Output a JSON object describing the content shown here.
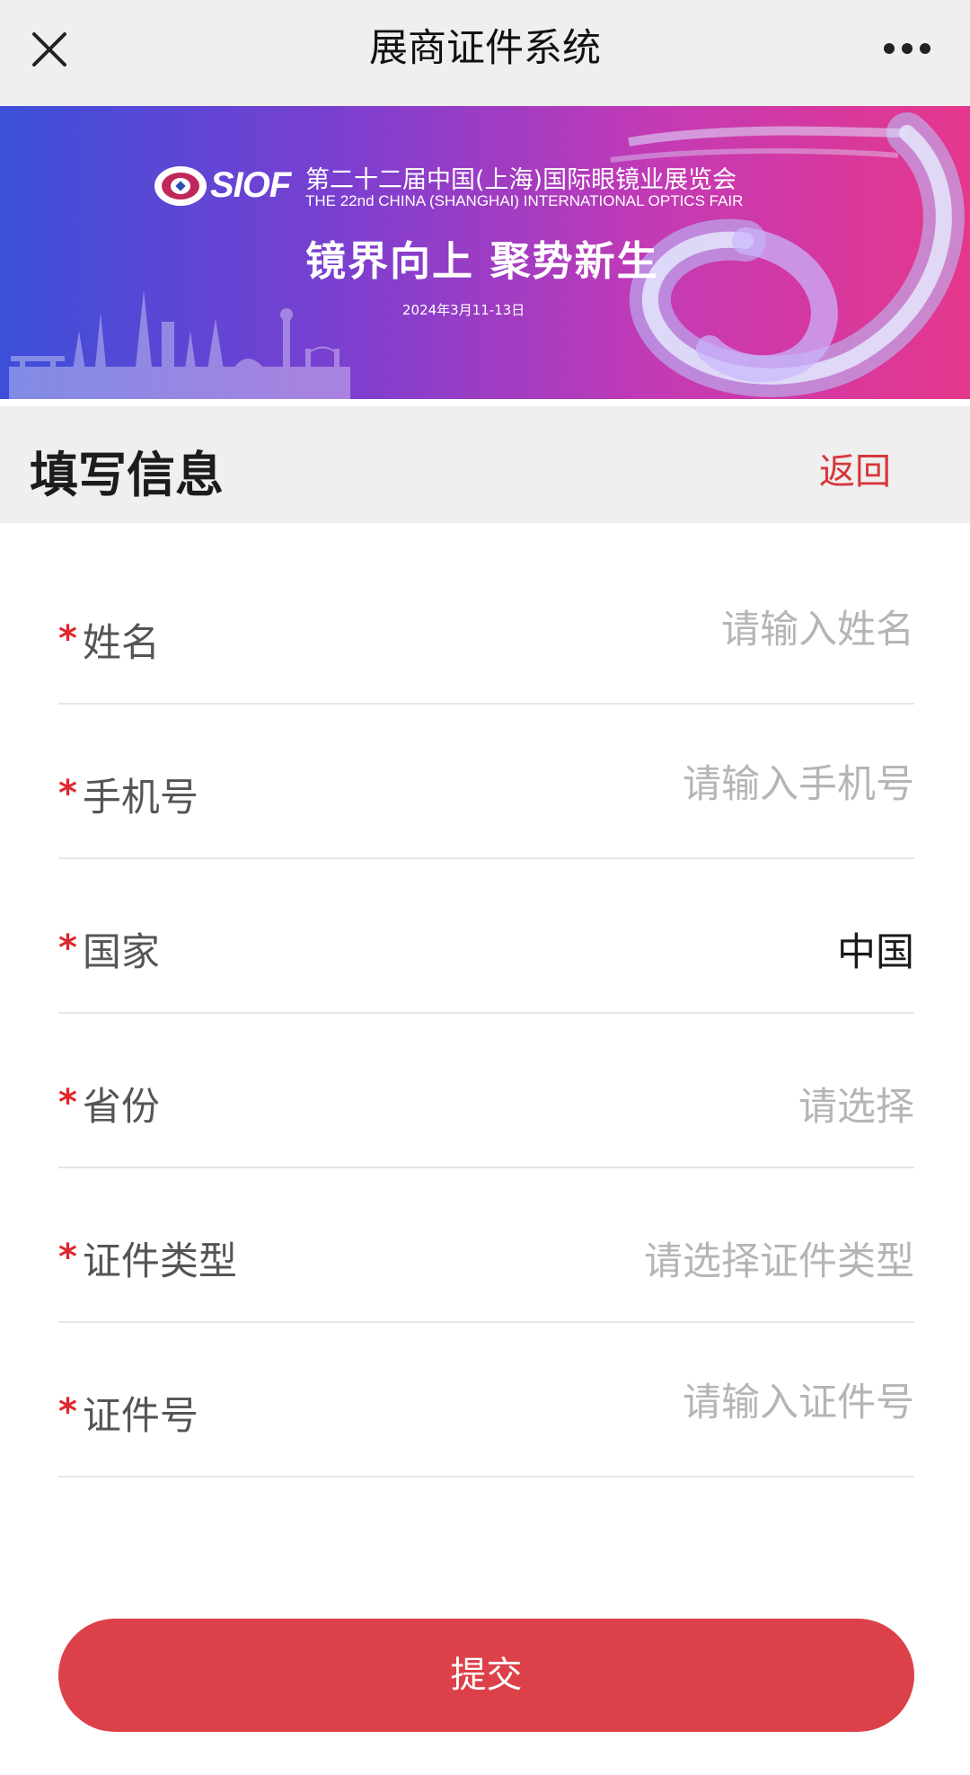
{
  "navbar": {
    "title": "展商证件系统",
    "close_icon": "close-icon",
    "more_icon": "more-dots-icon"
  },
  "banner": {
    "logo_text": "SIOF",
    "title_cn": "第二十二届中国(上海)国际眼镜业展览会",
    "title_en": "THE 22nd CHINA (SHANGHAI) INTERNATIONAL OPTICS FAIR",
    "slogan": "镜界向上 聚势新生",
    "date": "2024年3月11-13日"
  },
  "section": {
    "title": "填写信息",
    "back_label": "返回"
  },
  "form": {
    "required_mark": "*",
    "fields": [
      {
        "label": "姓名",
        "type": "input",
        "value": "",
        "placeholder": "请输入姓名"
      },
      {
        "label": "手机号",
        "type": "input",
        "value": "",
        "placeholder": "请输入手机号"
      },
      {
        "label": "国家",
        "type": "select",
        "value": "中国",
        "placeholder": ""
      },
      {
        "label": "省份",
        "type": "select",
        "value": "",
        "placeholder": "请选择"
      },
      {
        "label": "证件类型",
        "type": "select",
        "value": "",
        "placeholder": "请选择证件类型"
      },
      {
        "label": "证件号",
        "type": "input",
        "value": "",
        "placeholder": "请输入证件号"
      }
    ]
  },
  "submit_label": "提交",
  "colors": {
    "accent_red": "#dc4149",
    "required_red": "#e0282e",
    "back_red": "#d6363c",
    "banner_left": "#3b4fd9",
    "banner_right": "#e5378c"
  }
}
